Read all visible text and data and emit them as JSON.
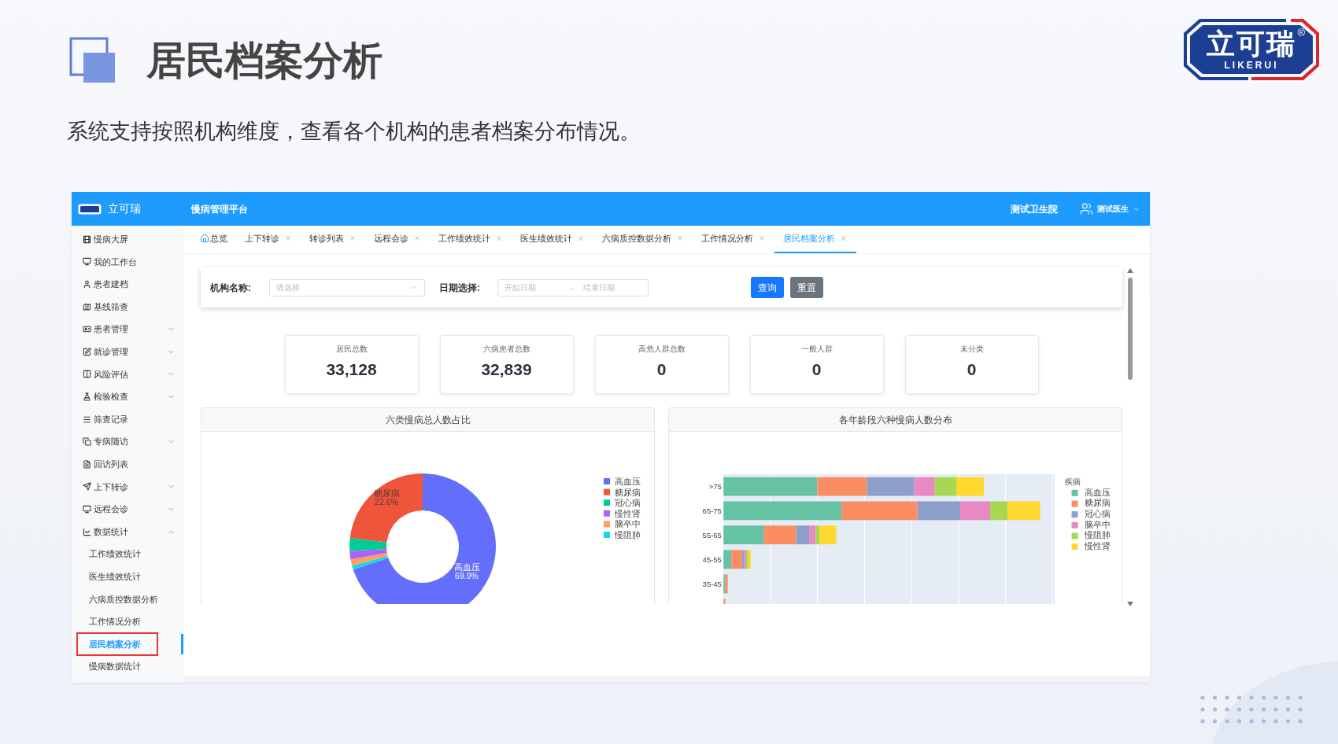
{
  "slide": {
    "title": "居民档案分析",
    "subtitle": "系统支持按照机构维度，查看各个机构的患者档案分布情况。",
    "logo": {
      "chinese": "立可瑞",
      "latin": "LIKERUI",
      "mark": "®"
    }
  },
  "app": {
    "brand": "立可瑞",
    "platform": "慢病管理平台",
    "org": "测试卫生院",
    "user": "测试医生"
  },
  "sidebar": {
    "items": [
      {
        "label": "慢病大屏",
        "kind": "link"
      },
      {
        "label": "我的工作台",
        "kind": "link"
      },
      {
        "label": "患者建档",
        "kind": "link"
      },
      {
        "label": "基线筛查",
        "kind": "link"
      },
      {
        "label": "患者管理",
        "kind": "group",
        "expanded": false
      },
      {
        "label": "就诊管理",
        "kind": "group",
        "expanded": false
      },
      {
        "label": "风险评估",
        "kind": "group",
        "expanded": false
      },
      {
        "label": "检验检查",
        "kind": "group",
        "expanded": false
      },
      {
        "label": "筛查记录",
        "kind": "link"
      },
      {
        "label": "专病随访",
        "kind": "group",
        "expanded": false
      },
      {
        "label": "回访列表",
        "kind": "link"
      },
      {
        "label": "上下转诊",
        "kind": "group",
        "expanded": false
      },
      {
        "label": "远程会诊",
        "kind": "group",
        "expanded": false
      },
      {
        "label": "数据统计",
        "kind": "group",
        "expanded": true,
        "children": [
          {
            "label": "工作绩效统计",
            "selected": false
          },
          {
            "label": "医生绩效统计",
            "selected": false
          },
          {
            "label": "六病质控数据分析",
            "selected": false
          },
          {
            "label": "工作情况分析",
            "selected": false
          },
          {
            "label": "居民档案分析",
            "selected": true
          },
          {
            "label": "慢病数据统计",
            "selected": false
          }
        ]
      }
    ]
  },
  "tabs": [
    {
      "label": "总览",
      "kind": "home",
      "selected": false
    },
    {
      "label": "上下转诊",
      "kind": "closable",
      "selected": false
    },
    {
      "label": "转诊列表",
      "kind": "closable",
      "selected": false
    },
    {
      "label": "远程会诊",
      "kind": "closable",
      "selected": false
    },
    {
      "label": "工作绩效统计",
      "kind": "closable",
      "selected": false
    },
    {
      "label": "医生绩效统计",
      "kind": "closable",
      "selected": false
    },
    {
      "label": "六病质控数据分析",
      "kind": "closable",
      "selected": false
    },
    {
      "label": "工作情况分析",
      "kind": "closable",
      "selected": false
    },
    {
      "label": "居民档案分析",
      "kind": "closable",
      "selected": true
    }
  ],
  "filter": {
    "org_label": "机构名称:",
    "org_placeholder": "请选择",
    "date_label": "日期选择:",
    "start_placeholder": "开始日期",
    "separator": "→",
    "end_placeholder": "结束日期",
    "buttons": [
      {
        "label": "查询",
        "kind": "primary"
      },
      {
        "label": "重置",
        "kind": "secondary"
      }
    ]
  },
  "stats": [
    {
      "label": "居民总数",
      "value": "33,128"
    },
    {
      "label": "六病患者总数",
      "value": "32,839"
    },
    {
      "label": "高危人群总数",
      "value": "0"
    },
    {
      "label": "一般人群",
      "value": "0"
    },
    {
      "label": "未分类",
      "value": "0"
    }
  ],
  "pie_panel": {
    "title": "六类慢病总人数占比",
    "slice_labels": [
      {
        "name": "高血压",
        "share": "69.9%"
      },
      {
        "name": "糖尿病",
        "share": "22.6%"
      }
    ],
    "legend": [
      {
        "label": "高血压",
        "color": "#636efa"
      },
      {
        "label": "糖尿病",
        "color": "#ef553b"
      },
      {
        "label": "冠心病",
        "color": "#00cc96"
      },
      {
        "label": "慢性肾",
        "color": "#ab63fa"
      },
      {
        "label": "脑卒中",
        "color": "#ffa15a"
      },
      {
        "label": "慢阻肺",
        "color": "#19d3f3"
      }
    ]
  },
  "bar_panel": {
    "title": "各年龄段六种慢病人数分布",
    "categories": [
      ">75",
      "65-75",
      "55-65",
      "45-55",
      "35-45"
    ],
    "legend_title": "疾病",
    "legend": [
      {
        "label": "高血压",
        "color": "#66c2a5"
      },
      {
        "label": "糖尿病",
        "color": "#fc8d62"
      },
      {
        "label": "冠心病",
        "color": "#8da0cb"
      },
      {
        "label": "脑卒中",
        "color": "#e78ac3"
      },
      {
        "label": "慢阻肺",
        "color": "#a6d854"
      },
      {
        "label": "慢性肾",
        "color": "#ffd92f"
      }
    ]
  }
}
